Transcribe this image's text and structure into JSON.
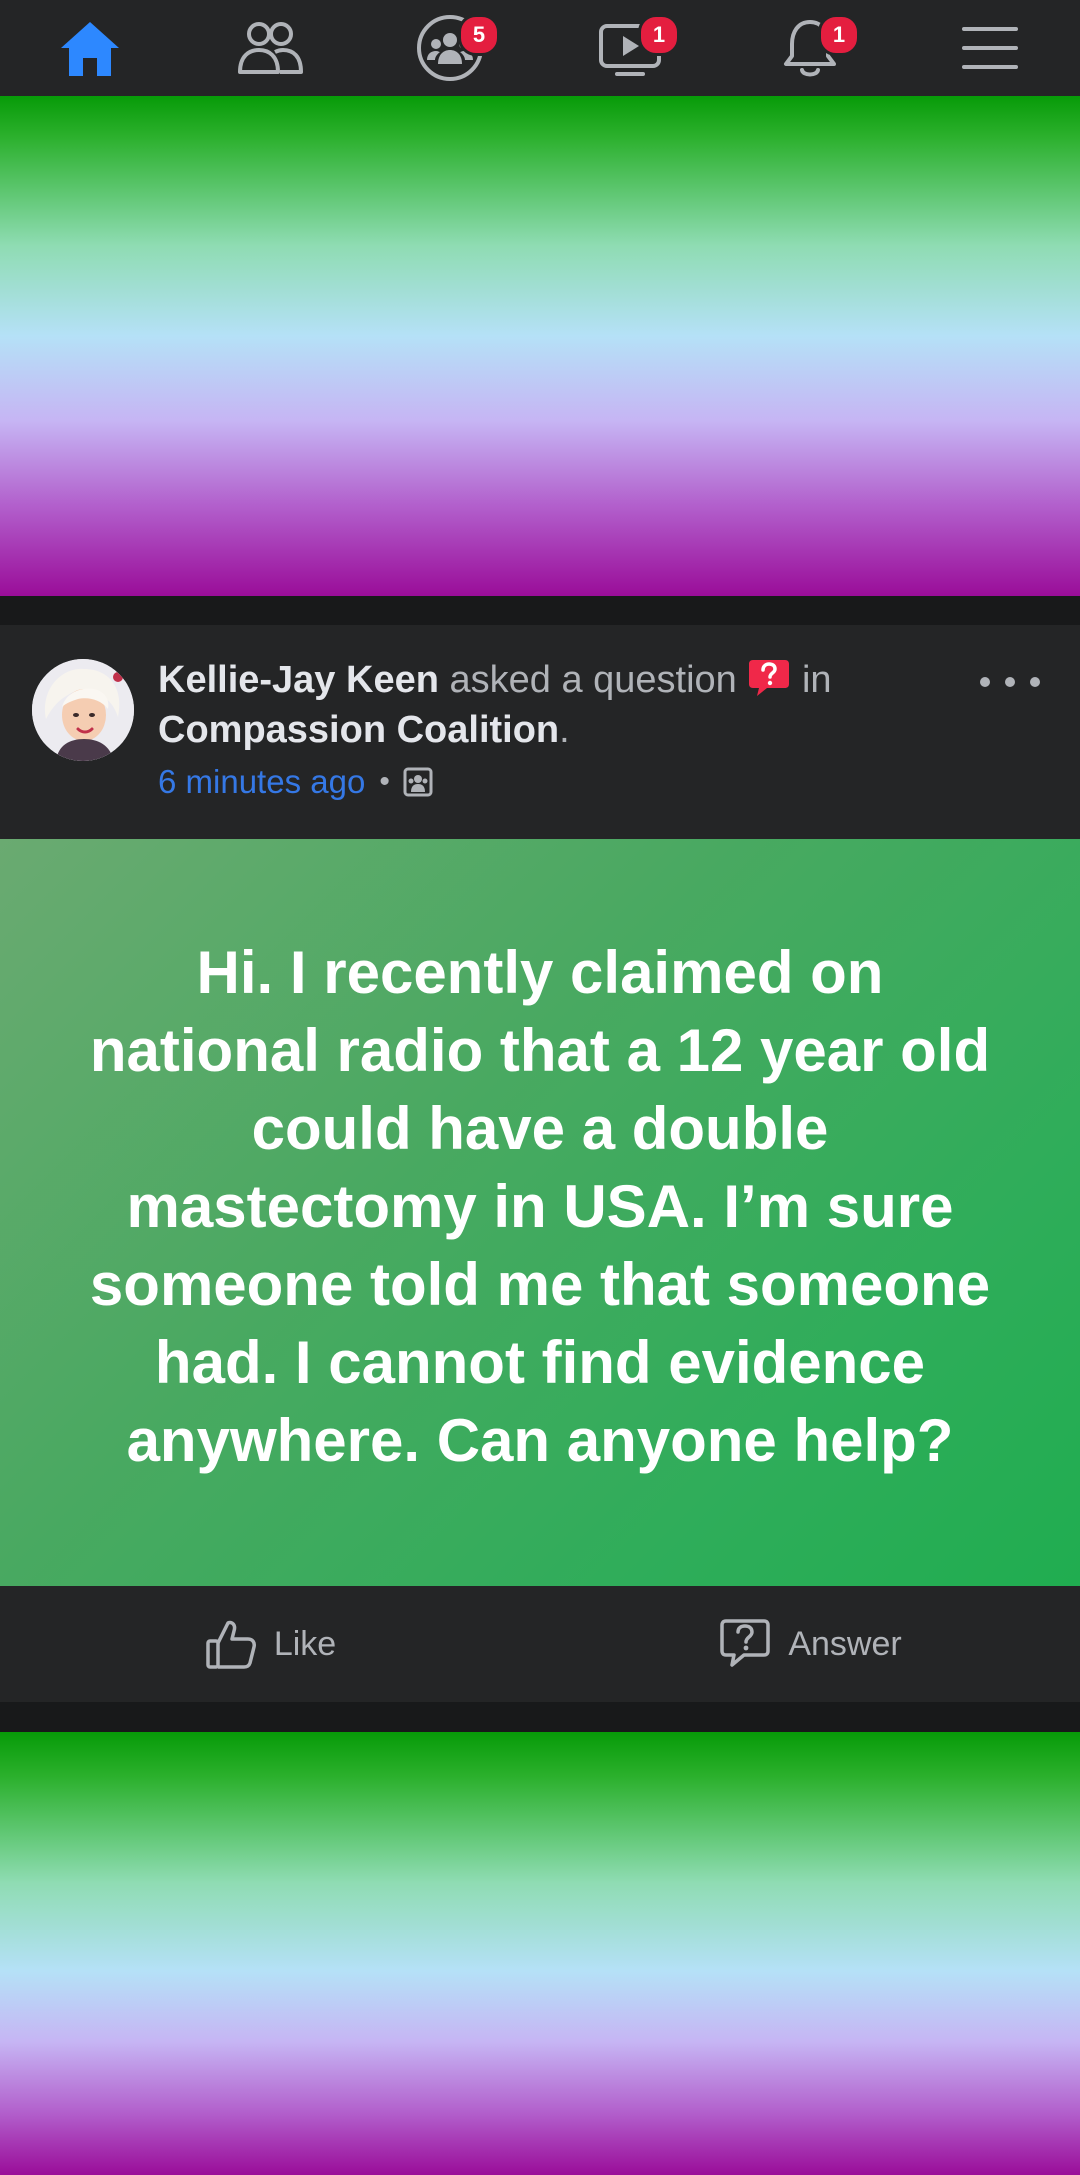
{
  "nav": {
    "items": [
      {
        "name": "home",
        "badge": ""
      },
      {
        "name": "friends",
        "badge": ""
      },
      {
        "name": "groups",
        "badge": "5"
      },
      {
        "name": "watch",
        "badge": "1"
      },
      {
        "name": "notifications",
        "badge": "1"
      },
      {
        "name": "menu",
        "badge": ""
      }
    ],
    "active_color": "#2d88ff",
    "badge_color": "#e41e3f"
  },
  "post": {
    "author": "Kellie-Jay Keen",
    "action": "asked a question",
    "in_word": "in",
    "group": "Compassion Coalition",
    "period": ".",
    "timestamp": "6 minutes ago",
    "separator": "•",
    "question": "Hi.  I recently claimed on\nnational radio that a 12 year old\ncould have a double\nmastectomy in USA.  I’m sure\nsomeone told me that someone\nhad.  I cannot find evidence\nanywhere. Can anyone help?",
    "like_label": "Like",
    "answer_label": "Answer"
  }
}
